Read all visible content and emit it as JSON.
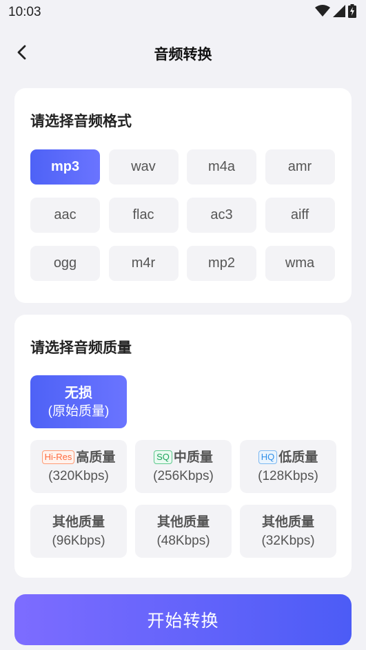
{
  "status_bar": {
    "time": "10:03"
  },
  "header": {
    "title": "音频转换"
  },
  "format_section": {
    "title": "请选择音频格式",
    "formats": [
      "mp3",
      "wav",
      "m4a",
      "amr",
      "aac",
      "flac",
      "ac3",
      "aiff",
      "ogg",
      "m4r",
      "mp2",
      "wma"
    ],
    "selected": "mp3"
  },
  "quality_section": {
    "title": "请选择音频质量",
    "lossless": {
      "line1": "无损",
      "line2": "(原始质量)"
    },
    "options": [
      {
        "badge": "Hi-Res",
        "label": "高质量",
        "rate": "(320Kbps)"
      },
      {
        "badge": "SQ",
        "label": "中质量",
        "rate": "(256Kbps)"
      },
      {
        "badge": "HQ",
        "label": "低质量",
        "rate": "(128Kbps)"
      },
      {
        "badge": "",
        "label": "其他质量",
        "rate": "(96Kbps)"
      },
      {
        "badge": "",
        "label": "其他质量",
        "rate": "(48Kbps)"
      },
      {
        "badge": "",
        "label": "其他质量",
        "rate": "(32Kbps)"
      }
    ],
    "selected": "lossless"
  },
  "start_button": {
    "label": "开始转换"
  },
  "colors": {
    "accent_start": "#4e62f6",
    "accent_end": "#6a74ff",
    "button_start": "#7d6cff",
    "button_end": "#4c5cf6",
    "page_bg": "#f2f2f6",
    "chip_bg": "#f3f3f6"
  },
  "icons": [
    "wifi-icon",
    "cellular-signal-icon",
    "battery-charging-icon",
    "back-arrow-icon"
  ]
}
